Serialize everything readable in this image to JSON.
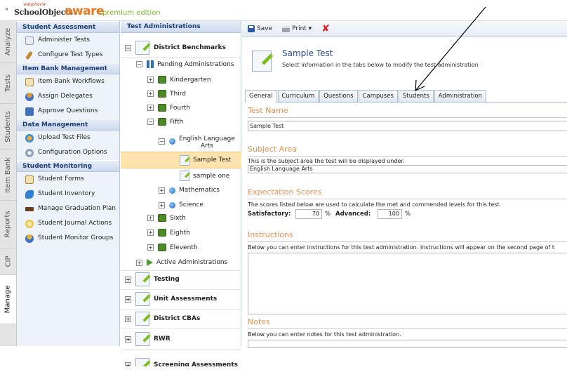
{
  "header": {
    "logo_tiny": "eduphoria!",
    "logo_main": "SchoolObjects",
    "logo_aware": "aware",
    "logo_edition": "premium edition"
  },
  "vtabs": [
    "Analyze",
    "Tests",
    "Students",
    "Item Bank",
    "Reports",
    "CIP",
    "Manage"
  ],
  "vtabs_collapse": "◂",
  "leftnav": {
    "sections": [
      {
        "title": "Student Assessment",
        "items": [
          "Administer Tests",
          "Configure Test Types"
        ]
      },
      {
        "title": "Item Bank Management",
        "items": [
          "Item Bank Workflows",
          "Assign Delegates",
          "Approve Questions"
        ]
      },
      {
        "title": "Data Management",
        "items": [
          "Upload Test Files",
          "Configuration Options"
        ]
      },
      {
        "title": "Student Monitoring",
        "items": [
          "Student Forms",
          "Student Inventory",
          "Manage Graduation Plan",
          "Student Journal Actions",
          "Student Monitor Groups"
        ]
      }
    ]
  },
  "tree": {
    "header": "Test Administrations",
    "district_benchmarks": "District Benchmarks",
    "pending": "Pending Administrations",
    "kindergarten": "Kindergarten",
    "third": "Third",
    "fourth": "Fourth",
    "fifth": "Fifth",
    "ela_line1": "English Language",
    "ela_line2": "Arts",
    "sample_test": "Sample Test",
    "sample_one": "sample one",
    "mathematics": "Mathematics",
    "science": "Science",
    "sixth": "Sixth",
    "eighth": "Eighth",
    "eleventh": "Eleventh",
    "active": "Active Administrations",
    "testing": "Testing",
    "unit": "Unit Assessments",
    "cba": "District CBAs",
    "rwr": "RWR",
    "cut": "Screening Assessments",
    "toggle_plus": "+",
    "toggle_minus": "−"
  },
  "toolbar": {
    "save": "Save",
    "print": "Print ▾",
    "delete": "✘"
  },
  "main": {
    "title": "Sample Test",
    "subtitle": "Select information in the tabs below to modify the test administration",
    "tabs": [
      "General",
      "Curriculum",
      "Questions",
      "Campuses",
      "Students",
      "Administration"
    ],
    "test_name_title": "Test Name",
    "test_name_value": "Sample Test",
    "subject_title": "Subject Area",
    "subject_hint": "This is the subject area the test will be displayed under.",
    "subject_value": "English Language Arts",
    "expect_title": "Expectation Scores",
    "expect_hint": "The scores listed below are used to calculate the met and commended levels for this test.",
    "satisfactory_label": "Satisfactory:",
    "satisfactory_value": "70",
    "advanced_label": "Advanced:",
    "advanced_value": "100",
    "percent": "%",
    "instructions_title": "Instructions",
    "instructions_hint": "Below you can enter instructions for this test administration. Instructions will appear on the second page of t",
    "notes_title": "Notes",
    "notes_hint": "Below you can enter notes for this test administration."
  },
  "colors": {
    "accent": "#e8914e",
    "nav_header": "#1c3d73",
    "selected": "#fde3ad"
  }
}
